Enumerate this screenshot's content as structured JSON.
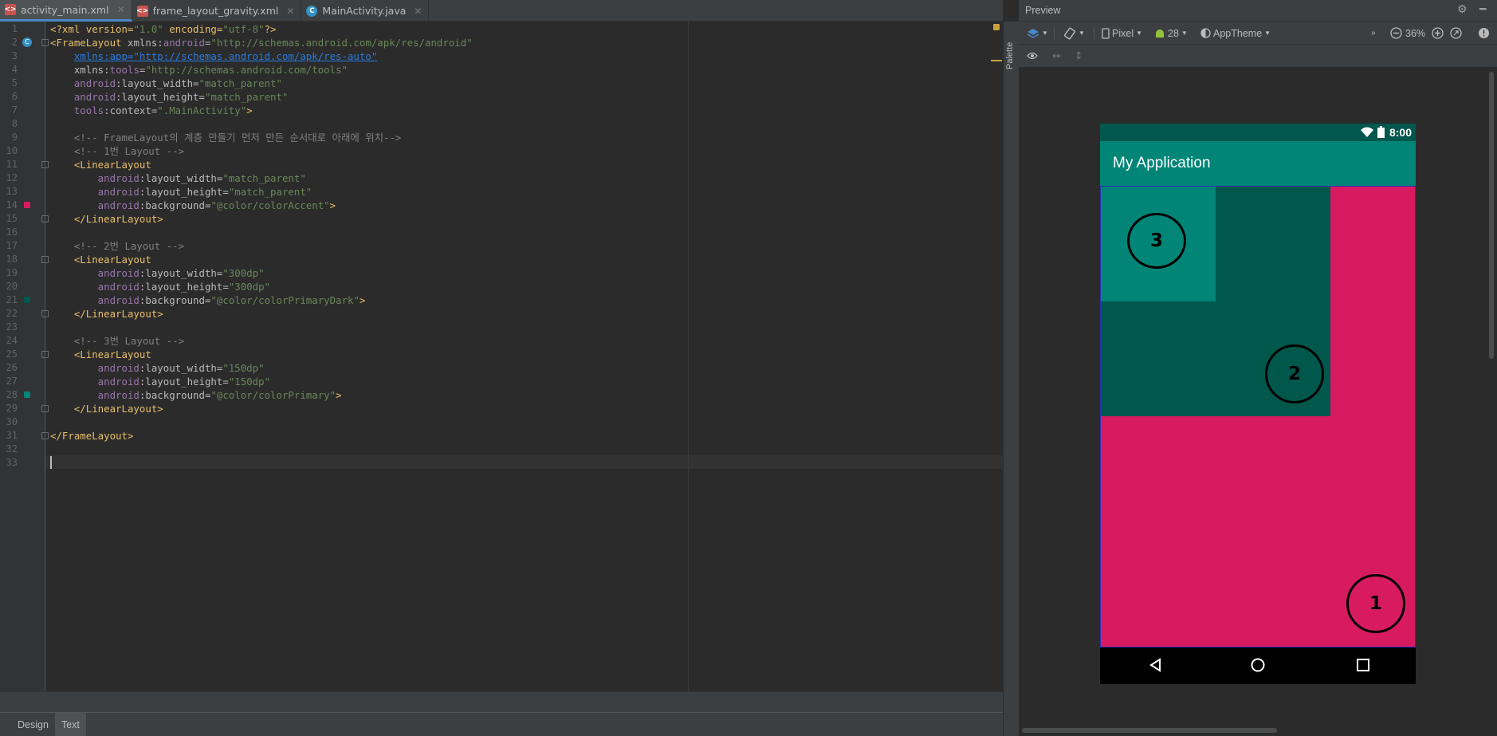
{
  "tabs": [
    {
      "label": "activity_main.xml",
      "icon": "xml-file-icon",
      "active": true
    },
    {
      "label": "frame_layout_gravity.xml",
      "icon": "xml-file-icon",
      "active": false
    },
    {
      "label": "MainActivity.java",
      "icon": "java-class-icon",
      "active": false
    }
  ],
  "editor": {
    "line_numbers": [
      "1",
      "2",
      "3",
      "4",
      "5",
      "6",
      "7",
      "8",
      "9",
      "10",
      "11",
      "12",
      "13",
      "14",
      "15",
      "16",
      "17",
      "18",
      "19",
      "20",
      "21",
      "22",
      "23",
      "24",
      "25",
      "26",
      "27",
      "28",
      "29",
      "30",
      "31",
      "32",
      "33"
    ],
    "lines": [
      [
        [
          "pi",
          "<?xml version="
        ],
        [
          "val",
          "\"1.0\""
        ],
        [
          "pi",
          " encoding="
        ],
        [
          "val",
          "\"utf-8\""
        ],
        [
          "pi",
          "?>"
        ]
      ],
      [
        [
          "tag",
          "<FrameLayout "
        ],
        [
          "attr",
          "xmlns:"
        ],
        [
          "ns",
          "android"
        ],
        [
          "attr",
          "="
        ],
        [
          "val",
          "\"http://schemas.android.com/apk/res/android\""
        ]
      ],
      [
        [
          "attr",
          "    "
        ],
        [
          "link",
          "xmlns:app=\"http://schemas.android.com/apk/res-auto\""
        ]
      ],
      [
        [
          "attr",
          "    xmlns:"
        ],
        [
          "ns",
          "tools"
        ],
        [
          "attr",
          "="
        ],
        [
          "val",
          "\"http://schemas.android.com/tools\""
        ]
      ],
      [
        [
          "ns",
          "    android"
        ],
        [
          "attr",
          ":layout_width="
        ],
        [
          "val",
          "\"match_parent\""
        ]
      ],
      [
        [
          "ns",
          "    android"
        ],
        [
          "attr",
          ":layout_height="
        ],
        [
          "val",
          "\"match_parent\""
        ]
      ],
      [
        [
          "ns",
          "    tools"
        ],
        [
          "attr",
          ":context="
        ],
        [
          "val",
          "\".MainActivity\""
        ],
        [
          "tag",
          ">"
        ]
      ],
      [],
      [
        [
          "cmt",
          "    <!-- FrameLayout의 계층 만들기 먼저 만든 순서대로 아래에 위치-->"
        ]
      ],
      [
        [
          "cmt",
          "    <!-- 1번 Layout -->"
        ]
      ],
      [
        [
          "tag",
          "    <LinearLayout"
        ]
      ],
      [
        [
          "ns",
          "        android"
        ],
        [
          "attr",
          ":layout_width="
        ],
        [
          "val",
          "\"match_parent\""
        ]
      ],
      [
        [
          "ns",
          "        android"
        ],
        [
          "attr",
          ":layout_height="
        ],
        [
          "val",
          "\"match_parent\""
        ]
      ],
      [
        [
          "ns",
          "        android"
        ],
        [
          "attr",
          ":background="
        ],
        [
          "val",
          "\"@color/colorAccent\""
        ],
        [
          "tag",
          ">"
        ]
      ],
      [
        [
          "tag",
          "    </LinearLayout>"
        ]
      ],
      [],
      [
        [
          "cmt",
          "    <!-- 2번 Layout -->"
        ]
      ],
      [
        [
          "tag",
          "    <LinearLayout"
        ]
      ],
      [
        [
          "ns",
          "        android"
        ],
        [
          "attr",
          ":layout_width="
        ],
        [
          "val",
          "\"300dp\""
        ]
      ],
      [
        [
          "ns",
          "        android"
        ],
        [
          "attr",
          ":layout_height="
        ],
        [
          "val",
          "\"300dp\""
        ]
      ],
      [
        [
          "ns",
          "        android"
        ],
        [
          "attr",
          ":background="
        ],
        [
          "val",
          "\"@color/colorPrimaryDark\""
        ],
        [
          "tag",
          ">"
        ]
      ],
      [
        [
          "tag",
          "    </LinearLayout>"
        ]
      ],
      [],
      [
        [
          "cmt",
          "    <!-- 3번 Layout -->"
        ]
      ],
      [
        [
          "tag",
          "    <LinearLayout"
        ]
      ],
      [
        [
          "ns",
          "        android"
        ],
        [
          "attr",
          ":layout_width="
        ],
        [
          "val",
          "\"150dp\""
        ]
      ],
      [
        [
          "ns",
          "        android"
        ],
        [
          "attr",
          ":layout_height="
        ],
        [
          "val",
          "\"150dp\""
        ]
      ],
      [
        [
          "ns",
          "        android"
        ],
        [
          "attr",
          ":background="
        ],
        [
          "val",
          "\"@color/colorPrimary\""
        ],
        [
          "tag",
          ">"
        ]
      ],
      [
        [
          "tag",
          "    </LinearLayout>"
        ]
      ],
      [],
      [
        [
          "tag",
          "</FrameLayout>"
        ]
      ],
      [],
      []
    ]
  },
  "bottom_tabs": [
    "Design",
    "Text"
  ],
  "palette_label": "Palette",
  "preview": {
    "title": "Preview",
    "device": "Pixel",
    "api": "28",
    "theme": "AppTheme",
    "zoom": "36%"
  },
  "phone": {
    "time": "8:00",
    "app_title": "My Application",
    "layouts": [
      {
        "label": "1",
        "color": "#d81b60"
      },
      {
        "label": "2",
        "color": "#00574b"
      },
      {
        "label": "3",
        "color": "#008577"
      }
    ]
  },
  "colors": {
    "colorAccent": "#d81b60",
    "colorPrimaryDark": "#00574b",
    "colorPrimary": "#008577"
  }
}
